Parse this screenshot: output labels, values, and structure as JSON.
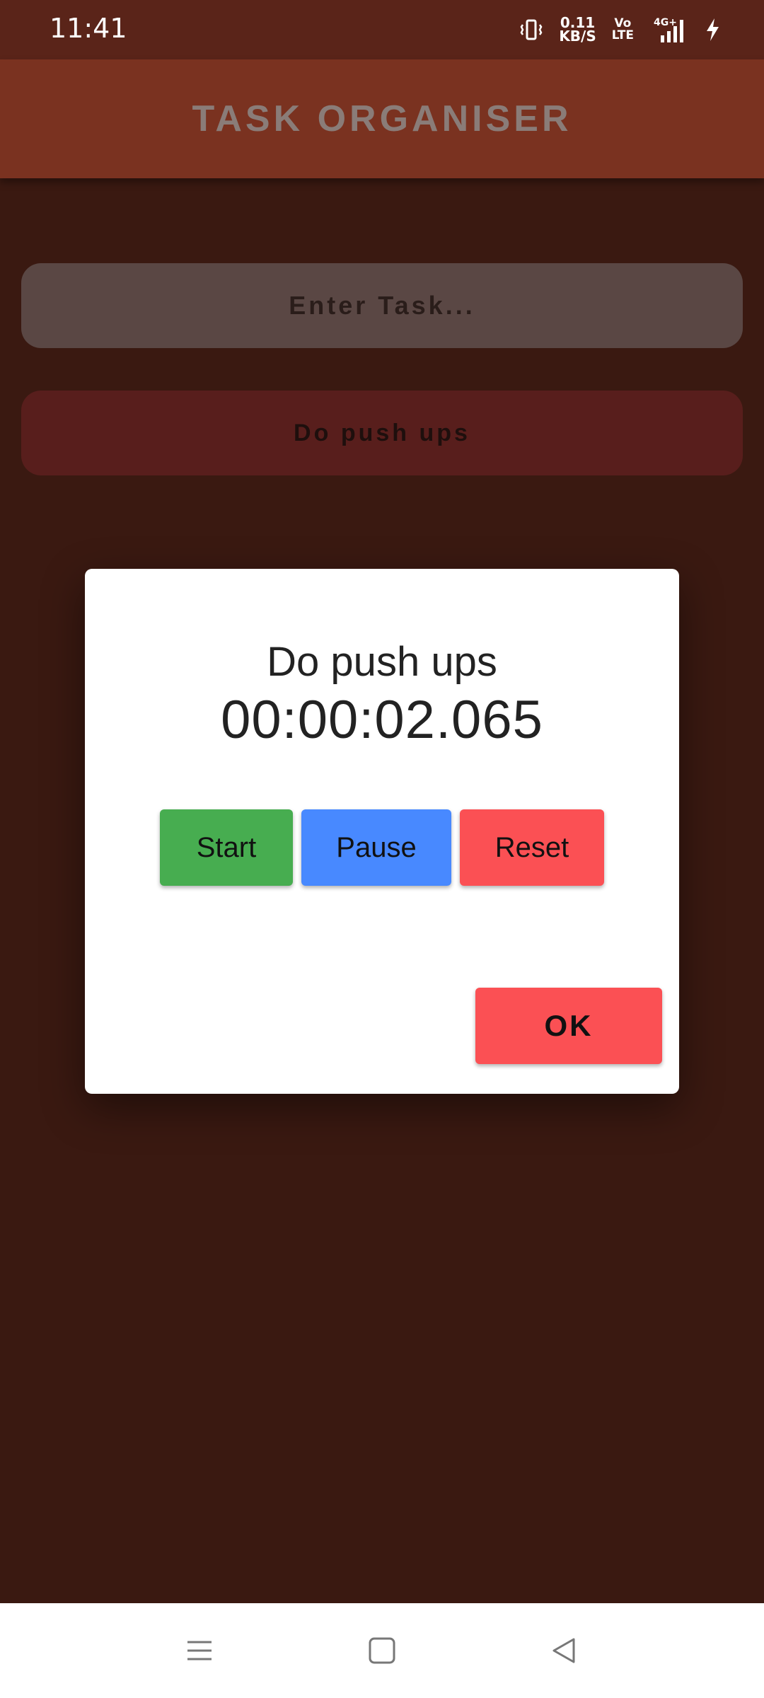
{
  "status_bar": {
    "time": "11:41",
    "net_speed_value": "0.11",
    "net_speed_unit": "KB/S",
    "volte_top": "Vo",
    "volte_bottom": "LTE",
    "network_type": "4G+",
    "icons": [
      "vibrate-icon",
      "network-speed",
      "volte-icon",
      "signal-icon",
      "charging-icon"
    ]
  },
  "app_bar": {
    "title": "TASK ORGANISER"
  },
  "task_input": {
    "placeholder": "Enter Task..."
  },
  "tasks": [
    {
      "label": "Do push ups"
    }
  ],
  "dialog": {
    "title": "Do push ups",
    "timer": "00:00:02.065",
    "buttons": {
      "start": "Start",
      "pause": "Pause",
      "reset": "Reset",
      "ok": "OK"
    }
  },
  "nav_bar": {
    "icons": [
      "menu-icon",
      "home-icon",
      "back-icon"
    ]
  },
  "colors": {
    "status_bar_bg": "#5a2419",
    "app_bar_bg": "#7a3220",
    "page_bg": "#3a1911",
    "input_bg": "#5a4744",
    "task_bg": "#581e1c",
    "start_green": "#47ad50",
    "pause_blue": "#4889ff",
    "reset_red": "#fb5054"
  }
}
